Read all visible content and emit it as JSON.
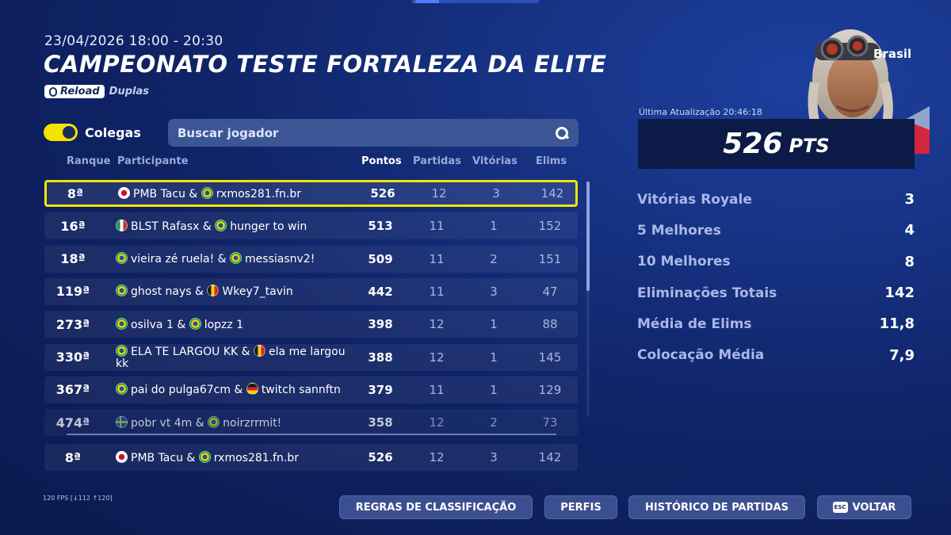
{
  "header": {
    "date": "23/04/2026 18:00 - 20:30",
    "title": "CAMPEONATO TESTE FORTALEZA DA ELITE",
    "tag_reload": "Reload",
    "mode": "Duplas"
  },
  "filters": {
    "toggle_label": "Colegas",
    "toggle_on": true,
    "search_placeholder": "Buscar jogador"
  },
  "table": {
    "columns": {
      "rank": "Ranque",
      "participant": "Participante",
      "points": "Pontos",
      "matches": "Partidas",
      "wins": "Vitórias",
      "elims": "Elims"
    },
    "rows": [
      {
        "rank": "8ª",
        "p1_flag": "jp",
        "p1": "PMB Tacu",
        "p2_flag": "br",
        "p2": "rxmos281.fn.br",
        "points": "526",
        "matches": "12",
        "wins": "3",
        "elims": "142"
      },
      {
        "rank": "16ª",
        "p1_flag": "it",
        "p1": "BLST Rafasx",
        "p2_flag": "br",
        "p2": "hunger to win",
        "points": "513",
        "matches": "11",
        "wins": "1",
        "elims": "152"
      },
      {
        "rank": "18ª",
        "p1_flag": "br",
        "p1": "vieira zé ruela!",
        "p2_flag": "br",
        "p2": "messiasnv2!",
        "points": "509",
        "matches": "11",
        "wins": "2",
        "elims": "151"
      },
      {
        "rank": "119ª",
        "p1_flag": "br",
        "p1": "ghost nays",
        "p2_flag": "be",
        "p2": "Wkey7_tavin",
        "points": "442",
        "matches": "11",
        "wins": "3",
        "elims": "47"
      },
      {
        "rank": "273ª",
        "p1_flag": "br",
        "p1": "osilva 1",
        "p2_flag": "br",
        "p2": "lopzz 1",
        "points": "398",
        "matches": "12",
        "wins": "1",
        "elims": "88"
      },
      {
        "rank": "330ª",
        "p1_flag": "br",
        "p1": "ELA TE LARGOU KK",
        "p2_flag": "be",
        "p2": "ela me largou kk",
        "points": "388",
        "matches": "12",
        "wins": "1",
        "elims": "145"
      },
      {
        "rank": "367ª",
        "p1_flag": "br",
        "p1": "pai do pulga67cm",
        "p2_flag": "de",
        "p2": "twitch sannftn",
        "points": "379",
        "matches": "11",
        "wins": "1",
        "elims": "129"
      },
      {
        "rank": "474ª",
        "p1_flag": "se",
        "p1": "pobr vt 4m",
        "p2_flag": "br",
        "p2": "noirzrrmit!",
        "points": "358",
        "matches": "12",
        "wins": "2",
        "elims": "73"
      }
    ],
    "pinned": {
      "rank": "8ª",
      "p1_flag": "jp",
      "p1": "PMB Tacu",
      "p2_flag": "br",
      "p2": "rxmos281.fn.br",
      "points": "526",
      "matches": "12",
      "wins": "3",
      "elims": "142"
    }
  },
  "profile": {
    "region": "Brasil",
    "last_update": "Última Atualização 20:46:18",
    "points": "526",
    "points_unit": "PTS",
    "stats": [
      {
        "label": "Vitórias Royale",
        "value": "3"
      },
      {
        "label": "5 Melhores",
        "value": "4"
      },
      {
        "label": "10 Melhores",
        "value": "8"
      },
      {
        "label": "Eliminações Totais",
        "value": "142"
      },
      {
        "label": "Média de Elims",
        "value": "11,8"
      },
      {
        "label": "Colocação Média",
        "value": "7,9"
      }
    ]
  },
  "footer": {
    "fps": "120 FPS [↓112 ↑120]",
    "buttons": {
      "rules": "REGRAS DE CLASSIFICAÇÃO",
      "profiles": "PERFIS",
      "history": "HISTÓRICO DE PARTIDAS",
      "back_key": "ESC",
      "back": "VOLTAR"
    }
  },
  "colors": {
    "highlight": "#f2e400",
    "panel_dark": "#0c1a47",
    "button": "#3b4f90"
  }
}
